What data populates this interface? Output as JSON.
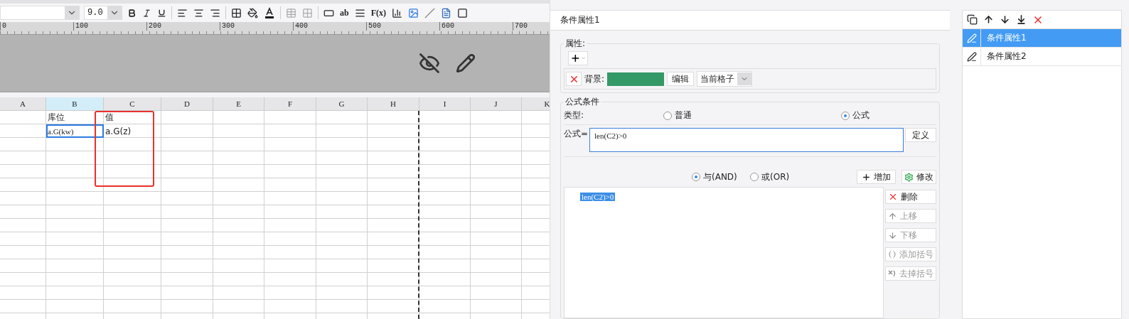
{
  "toolbar": {
    "font_size": "9.0",
    "text_tools": [
      "ab",
      "F(x)"
    ]
  },
  "ruler": {
    "labels": [
      "0",
      "100",
      "200",
      "300",
      "400",
      "500",
      "600",
      "700"
    ]
  },
  "sheet": {
    "columns": [
      {
        "label": "A",
        "selected": false
      },
      {
        "label": "B",
        "selected": true,
        "cells": [
          {
            "text": "库位",
            "selected": false
          },
          {
            "text": "a.G(kw)",
            "selected": true
          }
        ]
      },
      {
        "label": "C",
        "selected": false,
        "cells": [
          {
            "text": "值",
            "selected": false
          },
          {
            "text": "a.G(z)",
            "selected": false
          }
        ]
      },
      {
        "label": "D",
        "selected": false
      },
      {
        "label": "E",
        "selected": false
      },
      {
        "label": "F",
        "selected": false
      },
      {
        "label": "G",
        "selected": false
      },
      {
        "label": "H",
        "selected": false
      },
      {
        "label": "I",
        "selected": false
      },
      {
        "label": "J",
        "selected": false
      },
      {
        "label": "K",
        "selected": false
      }
    ]
  },
  "dialog": {
    "title": "条件属性1",
    "attributes": {
      "legend": "属性:",
      "background_label": "背景:",
      "color": "#339966",
      "edit_button": "编辑",
      "scope": "当前格子"
    },
    "formula": {
      "legend": "公式条件",
      "type_label": "类型:",
      "types": [
        {
          "label": "普通",
          "selected": false
        },
        {
          "label": "公式",
          "selected": true
        }
      ],
      "formula_label": "公式=",
      "value": "len(C2)>0",
      "define_button": "定义",
      "logic": [
        {
          "label": "与(AND)",
          "selected": true
        },
        {
          "label": "或(OR)",
          "selected": false
        }
      ],
      "add_button": "增加",
      "modify_button": "修改",
      "conditions": [
        {
          "label": "len(C2)>0",
          "selected": true
        }
      ],
      "side_buttons": [
        {
          "kind": "delete",
          "label": "删除",
          "disabled": false
        },
        {
          "kind": "up",
          "label": "上移",
          "disabled": true
        },
        {
          "kind": "down",
          "label": "下移",
          "disabled": true
        },
        {
          "kind": "add_paren",
          "label": "添加括号",
          "disabled": true
        },
        {
          "kind": "remove_paren",
          "label": "去掉括号",
          "disabled": true
        }
      ]
    }
  },
  "condition_list": {
    "items": [
      {
        "label": "条件属性1",
        "selected": true
      },
      {
        "label": "条件属性2",
        "selected": false
      }
    ]
  }
}
